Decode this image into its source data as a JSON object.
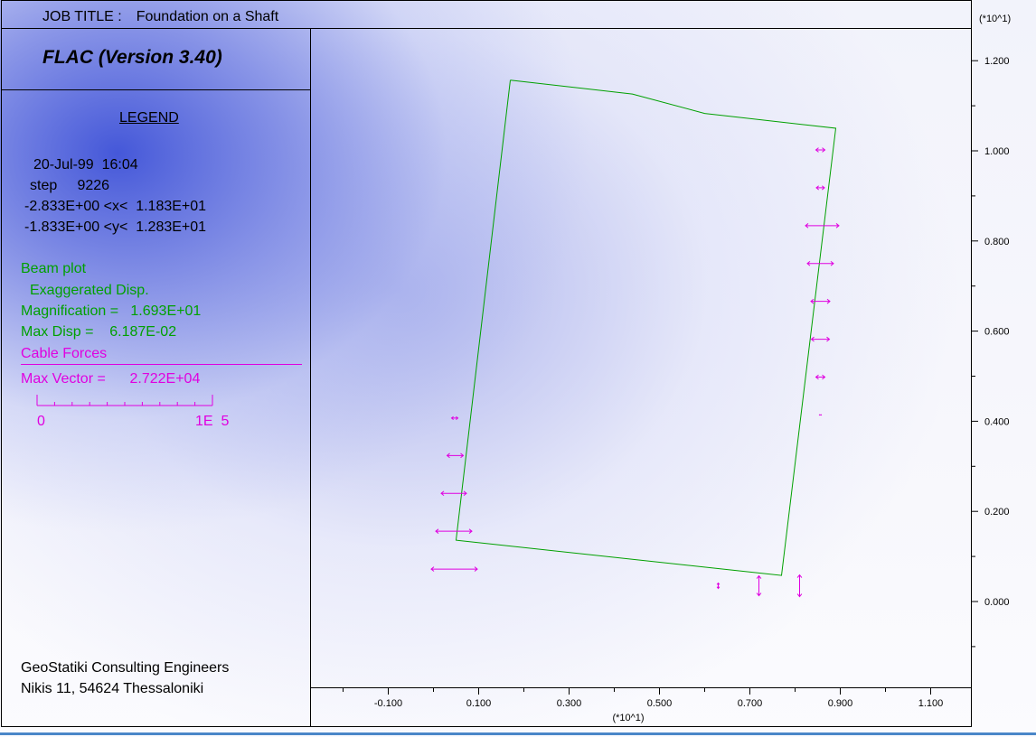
{
  "header": {
    "job_title_label": "JOB TITLE :",
    "job_title_value": "Foundation on a Shaft",
    "program": "FLAC (Version 3.40)"
  },
  "legend": {
    "title": "LEGEND",
    "date_time": "20-Jul-99  16:04",
    "step": "step     9226",
    "x_range": "-2.833E+00 <x<  1.183E+01",
    "y_range": "-1.833E+00 <y<  1.283E+01",
    "beam_plot": "Beam plot",
    "exaggerated": "Exaggerated Disp.",
    "magnification": "Magnification =   1.693E+01",
    "max_disp": "Max Disp =    6.187E-02",
    "cable_forces": "Cable Forces",
    "max_vector": "Max Vector =      2.722E+04",
    "scale_min": "0",
    "scale_max": "1E  5"
  },
  "footer": {
    "company": "GeoStatiki Consulting Engineers",
    "address": "Nikis 11, 54624 Thessaloniki"
  },
  "colors": {
    "beam": "#00a000",
    "cable": "#e000e0",
    "frame": "#000000"
  },
  "chart_data": {
    "type": "diagram",
    "axes": {
      "x_multiplier": "(*10^1)",
      "y_multiplier": "(*10^1)",
      "x_ticks": [
        -0.1,
        0.1,
        0.3,
        0.5,
        0.7,
        0.9,
        1.1
      ],
      "x_tick_labels": [
        "-0.100",
        "0.100",
        "0.300",
        "0.500",
        "0.700",
        "0.900",
        "1.100"
      ],
      "y_ticks": [
        0.0,
        0.2,
        0.4,
        0.6,
        0.8,
        1.0,
        1.2
      ],
      "y_tick_labels": [
        "0.000",
        "0.200",
        "0.400",
        "0.600",
        "0.800",
        "1.000",
        "1.200"
      ],
      "xlim": [
        -0.283,
        1.183
      ],
      "ylim": [
        -0.183,
        1.283
      ]
    },
    "beam_outline": [
      [
        0.17,
        1.157
      ],
      [
        0.44,
        1.126
      ],
      [
        0.6,
        1.083
      ],
      [
        0.89,
        1.05
      ],
      [
        0.77,
        0.058
      ],
      [
        0.05,
        0.136
      ],
      [
        0.17,
        1.157
      ]
    ],
    "cable_vectors": [
      {
        "x": 0.856,
        "y": 1.002,
        "half_len": 0.01,
        "dir": "h"
      },
      {
        "x": 0.856,
        "y": 0.918,
        "half_len": 0.009,
        "dir": "h"
      },
      {
        "x": 0.86,
        "y": 0.834,
        "half_len": 0.037,
        "dir": "h"
      },
      {
        "x": 0.856,
        "y": 0.75,
        "half_len": 0.029,
        "dir": "h"
      },
      {
        "x": 0.856,
        "y": 0.666,
        "half_len": 0.021,
        "dir": "h"
      },
      {
        "x": 0.856,
        "y": 0.582,
        "half_len": 0.02,
        "dir": "h"
      },
      {
        "x": 0.856,
        "y": 0.498,
        "half_len": 0.01,
        "dir": "h"
      },
      {
        "x": 0.856,
        "y": 0.414,
        "half_len": 0.002,
        "dir": "h"
      },
      {
        "x": 0.047,
        "y": 0.407,
        "half_len": 0.007,
        "dir": "h"
      },
      {
        "x": 0.048,
        "y": 0.324,
        "half_len": 0.018,
        "dir": "h"
      },
      {
        "x": 0.045,
        "y": 0.24,
        "half_len": 0.028,
        "dir": "h"
      },
      {
        "x": 0.045,
        "y": 0.156,
        "half_len": 0.04,
        "dir": "h"
      },
      {
        "x": 0.046,
        "y": 0.072,
        "half_len": 0.051,
        "dir": "h"
      },
      {
        "x": 0.63,
        "y": 0.035,
        "half_len": 0.006,
        "dir": "v"
      },
      {
        "x": 0.72,
        "y": 0.035,
        "half_len": 0.022,
        "dir": "v"
      },
      {
        "x": 0.81,
        "y": 0.035,
        "half_len": 0.024,
        "dir": "v"
      }
    ]
  }
}
